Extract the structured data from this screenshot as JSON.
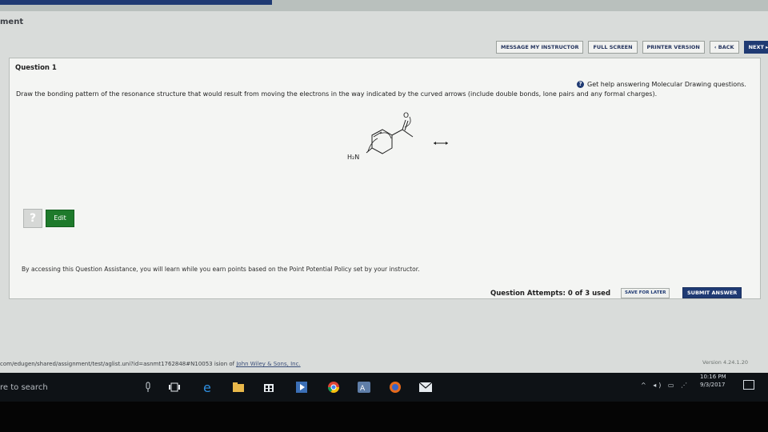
{
  "page": {
    "title_fragment": "ment"
  },
  "toolbar": {
    "message_instructor": "MESSAGE MY INSTRUCTOR",
    "full_screen": "FULL SCREEN",
    "printer_version": "PRINTER VERSION",
    "back": "‹ BACK",
    "next": "NEXT ▸"
  },
  "question": {
    "title": "Question 1",
    "help_text": "Get help answering Molecular Drawing questions.",
    "prompt": "Draw the bonding pattern of the resonance structure that would result from moving the electrons in the way indicated by the curved arrows (include double bonds, lone pairs and any formal charges).",
    "molecule": {
      "oxygen_label": "O",
      "amine_label": "H₂N"
    },
    "edit_label": "Edit",
    "question_mark": "?",
    "assistance_text": "By accessing this Question Assistance, you will learn while you earn points based on the Point Potential Policy set by your instructor.",
    "attempts": "Question Attempts: 0 of 3 used",
    "save_later": "SAVE FOR LATER",
    "submit": "SUBMIT ANSWER"
  },
  "footer": {
    "url": "com/edugen/shared/assignment/test/aglist.uni?id=asnmt1762848#N10053",
    "copyright_prefix": "ision of",
    "copyright_link": "John Wiley & Sons, Inc.",
    "version": "Version 4.24.1.20"
  },
  "taskbar": {
    "search_text": "re to search",
    "time": "10:16 PM",
    "date": "9/3/2017"
  },
  "colors": {
    "accent": "#1f3a73",
    "edit_green": "#1e7a2b",
    "taskbar": "#0e1216"
  }
}
